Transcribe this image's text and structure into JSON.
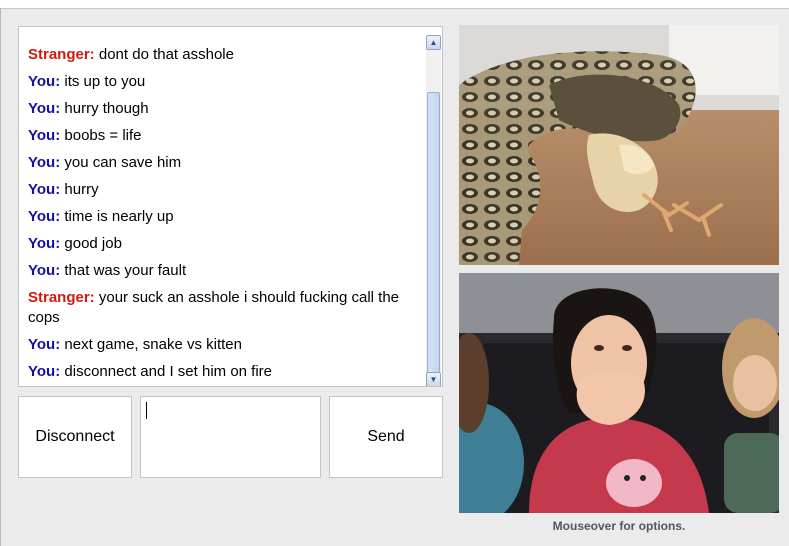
{
  "chat": {
    "messages": [
      {
        "sender": "Stranger:",
        "text": "dont do that asshole",
        "role": "stranger"
      },
      {
        "sender": "You:",
        "text": "its up to you",
        "role": "you"
      },
      {
        "sender": "You:",
        "text": "hurry though",
        "role": "you"
      },
      {
        "sender": "You:",
        "text": "boobs = life",
        "role": "you"
      },
      {
        "sender": "You:",
        "text": "you can save him",
        "role": "you"
      },
      {
        "sender": "You:",
        "text": "hurry",
        "role": "you"
      },
      {
        "sender": "You:",
        "text": "time is nearly up",
        "role": "you"
      },
      {
        "sender": "You:",
        "text": "good job",
        "role": "you"
      },
      {
        "sender": "You:",
        "text": "that was your fault",
        "role": "you"
      },
      {
        "sender": "Stranger:",
        "text": "your suck an asshole i should fucking call the cops",
        "role": "stranger"
      },
      {
        "sender": "You:",
        "text": "next game, snake vs kitten",
        "role": "you"
      },
      {
        "sender": "You:",
        "text": "disconnect and I set him on fire",
        "role": "you"
      }
    ]
  },
  "controls": {
    "disconnect_label": "Disconnect",
    "send_label": "Send",
    "message_value": ""
  },
  "video": {
    "caption": "Mouseover for options."
  },
  "colors": {
    "stranger": "#d11a0e",
    "you": "#1410a6",
    "panel_bg": "#ebebeb"
  },
  "icons": {
    "scroll_up": "scroll-up-arrow",
    "scroll_down": "scroll-down-arrow"
  }
}
